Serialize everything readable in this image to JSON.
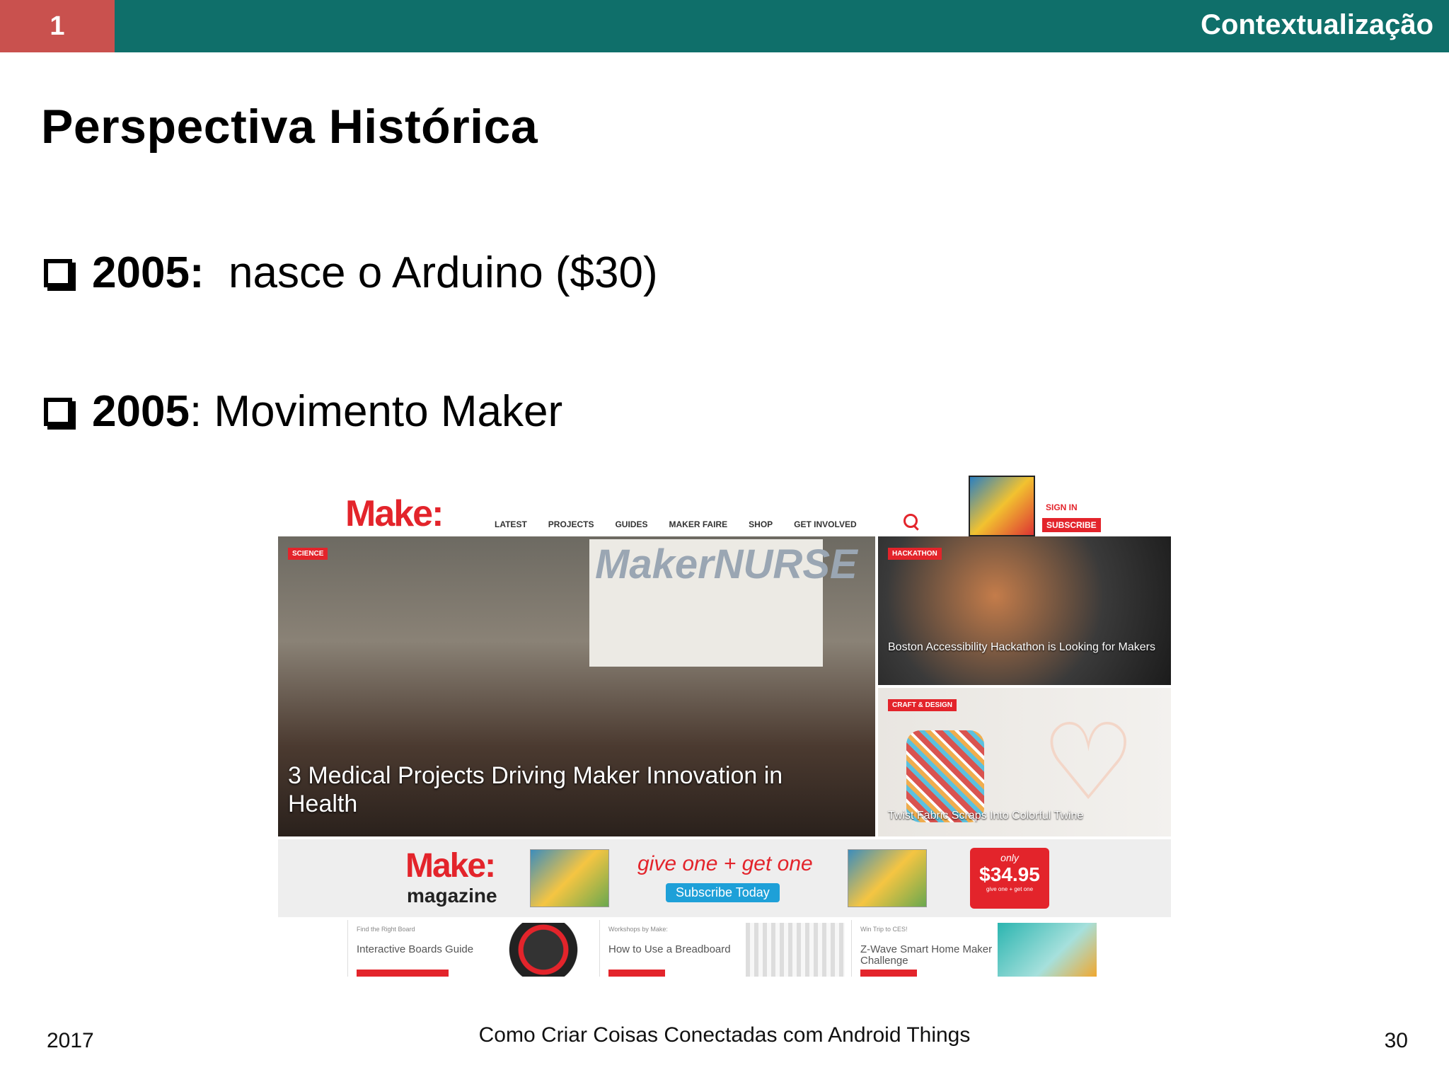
{
  "header": {
    "section_number": "1",
    "section_title": "Contextualização"
  },
  "slide": {
    "title": "Perspectiva Histórica",
    "bullets": [
      {
        "year": "2005:",
        "text": "  nasce o Arduino ($30)"
      },
      {
        "year": "2005",
        "text": ": Movimento Maker"
      }
    ]
  },
  "screenshot": {
    "logo": "Make:",
    "nav_items": [
      "LATEST",
      "PROJECTS",
      "GUIDES",
      "MAKER FAIRE",
      "SHOP",
      "GET INVOLVED"
    ],
    "sign_in": "SIGN IN",
    "subscribe": "SUBSCRIBE",
    "hero": {
      "tag": "SCIENCE",
      "banner": "MakerNURSE",
      "caption": "3 Medical Projects Driving Maker Innovation in Health"
    },
    "side_stories": [
      {
        "tag": "HACKATHON",
        "caption": "Boston Accessibility Hackathon is Looking for Makers"
      },
      {
        "tag": "CRAFT & DESIGN",
        "caption": "Twist Fabric Scraps Into Colorful Twine"
      }
    ],
    "promo": {
      "logo": "Make:",
      "subtitle": "magazine",
      "offer": "give one + get one",
      "button": "Subscribe Today",
      "price_prefix": "only",
      "price": "$34.95",
      "price_note": "give one + get one"
    },
    "cards": [
      {
        "kicker": "Find the Right Board",
        "title": "Interactive Boards Guide"
      },
      {
        "kicker": "Workshops by Make:",
        "title": "How to Use a Breadboard"
      },
      {
        "kicker": "Win Trip to CES!",
        "title": "Z-Wave Smart Home Maker Challenge"
      }
    ]
  },
  "footer": {
    "year": "2017",
    "course": "Como Criar Coisas Conectadas com Android Things",
    "page": "30"
  },
  "colors": {
    "header_bar": "#0f6f6a",
    "section_badge": "#c9514e",
    "make_red": "#e3242b"
  }
}
